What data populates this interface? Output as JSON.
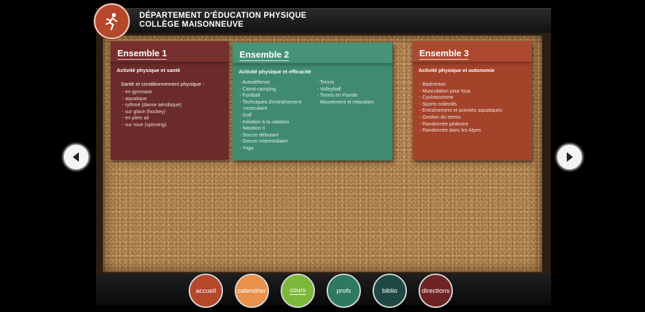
{
  "header": {
    "line1": "DÉPARTEMENT D'ÉDUCATION PHYSIQUE",
    "line2": "COLLÈGE MAISONNEUVE"
  },
  "cards": [
    {
      "title": "Ensemble 1",
      "subtitle": "Activité physique et santé",
      "group_label": "Santé et conditionnement physique :",
      "items": [
        "en gymnase",
        "aquatique",
        "rythmé (danse aérobique)",
        "sur glace (hockey)",
        "en plein air",
        "sur roue (spinning)"
      ]
    },
    {
      "title": "Ensemble 2",
      "subtitle": "Activité physique et efficacité",
      "col1": [
        "Autodéfense",
        "Canot-camping",
        "Football",
        "Techniques d'entraînement musculaire",
        "Golf",
        "Initiation à la natation",
        "Natation II",
        "Soccer débutant",
        "Soccer intermédiaire",
        "Yoga"
      ],
      "col2": [
        "Tennis",
        "Volleyball",
        "Tennis en Floride",
        "Mouvement et relaxation"
      ]
    },
    {
      "title": "Ensemble 3",
      "subtitle": "Activité physique et autonomie",
      "items": [
        "Badminton",
        "Musculation pour tous",
        "Cyclotourisme",
        "Sports collectifs",
        "Entraînement et activités aquatiques",
        "Gestion du stress",
        "Randonnée pédestre",
        "Randonnée dans les Alpes"
      ]
    }
  ],
  "nav": [
    {
      "label": "accueil",
      "color": "#b5472b"
    },
    {
      "label": "calendrier",
      "color": "#e8914a"
    },
    {
      "label": "cours",
      "color": "#7db83c",
      "active": true
    },
    {
      "label": "profs",
      "color": "#2f7a5e"
    },
    {
      "label": "biblio",
      "color": "#1f4a44"
    },
    {
      "label": "directions",
      "color": "#6e2424"
    }
  ],
  "icons": {
    "logo": "runner-icon",
    "prev": "arrow-left-icon",
    "next": "arrow-right-icon"
  }
}
